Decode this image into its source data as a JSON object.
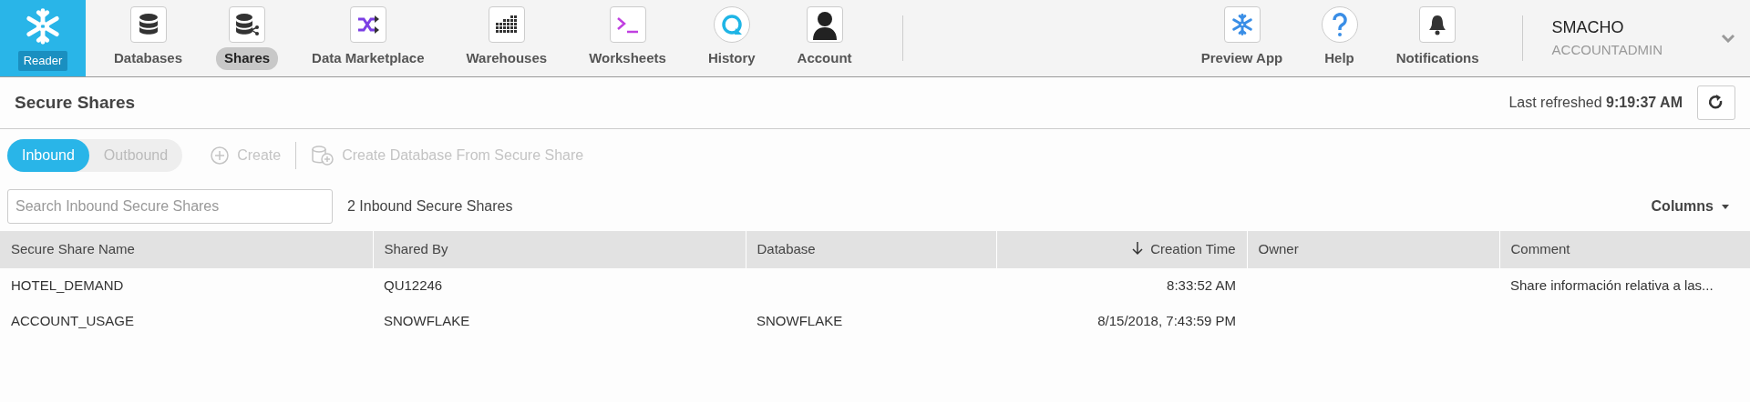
{
  "logo": {
    "badge": "Reader"
  },
  "nav": [
    {
      "label": "Databases",
      "selected": false
    },
    {
      "label": "Shares",
      "selected": true
    },
    {
      "label": "Data Marketplace",
      "selected": false
    },
    {
      "label": "Warehouses",
      "selected": false
    },
    {
      "label": "Worksheets",
      "selected": false
    },
    {
      "label": "History",
      "selected": false
    },
    {
      "label": "Account",
      "selected": false
    }
  ],
  "nav_right": [
    {
      "label": "Preview App"
    },
    {
      "label": "Help"
    },
    {
      "label": "Notifications"
    }
  ],
  "user": {
    "name": "SMACHO",
    "role": "ACCOUNTADMIN"
  },
  "page": {
    "title": "Secure Shares",
    "refreshed_label": "Last refreshed",
    "refreshed_time": "9:19:37 AM"
  },
  "tabs": [
    {
      "label": "Inbound",
      "selected": true
    },
    {
      "label": "Outbound",
      "selected": false
    }
  ],
  "actions": [
    {
      "label": "Create",
      "disabled": true
    },
    {
      "label": "Create Database From Secure Share",
      "disabled": true
    }
  ],
  "search": {
    "placeholder": "Search Inbound Secure Shares"
  },
  "count": "2 Inbound Secure Shares",
  "columns_button": "Columns",
  "table": {
    "columns": [
      {
        "label": "Secure Share Name",
        "sorted": false
      },
      {
        "label": "Shared By",
        "sorted": false
      },
      {
        "label": "Database",
        "sorted": false
      },
      {
        "label": "Creation Time",
        "sorted": true
      },
      {
        "label": "Owner",
        "sorted": false
      },
      {
        "label": "Comment",
        "sorted": false
      }
    ],
    "rows": [
      [
        "HOTEL_DEMAND",
        "QU12246",
        "",
        "8:33:52 AM",
        "",
        "Share información relativa a las..."
      ],
      [
        "ACCOUNT_USAGE",
        "SNOWFLAKE",
        "SNOWFLAKE",
        "8/15/2018, 7:43:59 PM",
        "",
        ""
      ]
    ]
  }
}
